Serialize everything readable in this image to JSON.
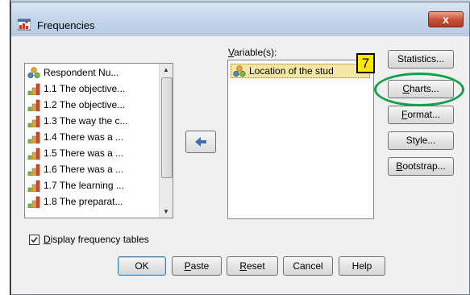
{
  "window": {
    "title": "Frequencies",
    "close_glyph": "x"
  },
  "source_list": {
    "items": [
      {
        "label": "Respondent Nu...",
        "icon": "nominal-variable-icon"
      },
      {
        "label": "1.1 The objective...",
        "icon": "ordinal-variable-icon"
      },
      {
        "label": "1.2 The objective...",
        "icon": "ordinal-variable-icon"
      },
      {
        "label": "1.3 The way the c...",
        "icon": "ordinal-variable-icon"
      },
      {
        "label": "1.4 There was a ...",
        "icon": "ordinal-variable-icon"
      },
      {
        "label": "1.5 There was a ...",
        "icon": "ordinal-variable-icon"
      },
      {
        "label": "1.6 There was a ...",
        "icon": "ordinal-variable-icon"
      },
      {
        "label": "1.7 The learning ...",
        "icon": "ordinal-variable-icon"
      },
      {
        "label": "1.8 The preparat...",
        "icon": "ordinal-variable-icon"
      }
    ]
  },
  "move_button": {
    "icon": "arrow-left-icon"
  },
  "variables": {
    "label": "Variable(s):",
    "items": [
      {
        "label": "Location of the stud",
        "icon": "nominal-variable-icon"
      }
    ]
  },
  "side_buttons": {
    "statistics": "Statistics...",
    "charts": "Charts...",
    "format": "Format...",
    "style": "Style...",
    "bootstrap": "Bootstrap..."
  },
  "annotation": {
    "step": "7",
    "accent": "#14a04a",
    "badge_color": "#ffe600"
  },
  "display_tables": {
    "label": "Display frequency tables",
    "checked": true
  },
  "bottom_buttons": {
    "ok": "OK",
    "paste": "Paste",
    "reset": "Reset",
    "cancel": "Cancel",
    "help": "Help"
  }
}
